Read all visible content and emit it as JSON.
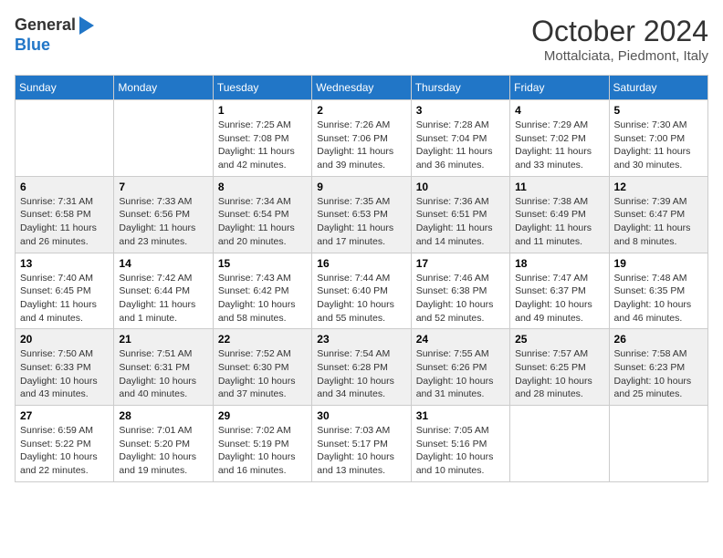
{
  "header": {
    "logo_general": "General",
    "logo_blue": "Blue",
    "month": "October 2024",
    "location": "Mottalciata, Piedmont, Italy"
  },
  "days_of_week": [
    "Sunday",
    "Monday",
    "Tuesday",
    "Wednesday",
    "Thursday",
    "Friday",
    "Saturday"
  ],
  "weeks": [
    [
      {
        "day": "",
        "content": ""
      },
      {
        "day": "",
        "content": ""
      },
      {
        "day": "1",
        "content": "Sunrise: 7:25 AM\nSunset: 7:08 PM\nDaylight: 11 hours and 42 minutes."
      },
      {
        "day": "2",
        "content": "Sunrise: 7:26 AM\nSunset: 7:06 PM\nDaylight: 11 hours and 39 minutes."
      },
      {
        "day": "3",
        "content": "Sunrise: 7:28 AM\nSunset: 7:04 PM\nDaylight: 11 hours and 36 minutes."
      },
      {
        "day": "4",
        "content": "Sunrise: 7:29 AM\nSunset: 7:02 PM\nDaylight: 11 hours and 33 minutes."
      },
      {
        "day": "5",
        "content": "Sunrise: 7:30 AM\nSunset: 7:00 PM\nDaylight: 11 hours and 30 minutes."
      }
    ],
    [
      {
        "day": "6",
        "content": "Sunrise: 7:31 AM\nSunset: 6:58 PM\nDaylight: 11 hours and 26 minutes."
      },
      {
        "day": "7",
        "content": "Sunrise: 7:33 AM\nSunset: 6:56 PM\nDaylight: 11 hours and 23 minutes."
      },
      {
        "day": "8",
        "content": "Sunrise: 7:34 AM\nSunset: 6:54 PM\nDaylight: 11 hours and 20 minutes."
      },
      {
        "day": "9",
        "content": "Sunrise: 7:35 AM\nSunset: 6:53 PM\nDaylight: 11 hours and 17 minutes."
      },
      {
        "day": "10",
        "content": "Sunrise: 7:36 AM\nSunset: 6:51 PM\nDaylight: 11 hours and 14 minutes."
      },
      {
        "day": "11",
        "content": "Sunrise: 7:38 AM\nSunset: 6:49 PM\nDaylight: 11 hours and 11 minutes."
      },
      {
        "day": "12",
        "content": "Sunrise: 7:39 AM\nSunset: 6:47 PM\nDaylight: 11 hours and 8 minutes."
      }
    ],
    [
      {
        "day": "13",
        "content": "Sunrise: 7:40 AM\nSunset: 6:45 PM\nDaylight: 11 hours and 4 minutes."
      },
      {
        "day": "14",
        "content": "Sunrise: 7:42 AM\nSunset: 6:44 PM\nDaylight: 11 hours and 1 minute."
      },
      {
        "day": "15",
        "content": "Sunrise: 7:43 AM\nSunset: 6:42 PM\nDaylight: 10 hours and 58 minutes."
      },
      {
        "day": "16",
        "content": "Sunrise: 7:44 AM\nSunset: 6:40 PM\nDaylight: 10 hours and 55 minutes."
      },
      {
        "day": "17",
        "content": "Sunrise: 7:46 AM\nSunset: 6:38 PM\nDaylight: 10 hours and 52 minutes."
      },
      {
        "day": "18",
        "content": "Sunrise: 7:47 AM\nSunset: 6:37 PM\nDaylight: 10 hours and 49 minutes."
      },
      {
        "day": "19",
        "content": "Sunrise: 7:48 AM\nSunset: 6:35 PM\nDaylight: 10 hours and 46 minutes."
      }
    ],
    [
      {
        "day": "20",
        "content": "Sunrise: 7:50 AM\nSunset: 6:33 PM\nDaylight: 10 hours and 43 minutes."
      },
      {
        "day": "21",
        "content": "Sunrise: 7:51 AM\nSunset: 6:31 PM\nDaylight: 10 hours and 40 minutes."
      },
      {
        "day": "22",
        "content": "Sunrise: 7:52 AM\nSunset: 6:30 PM\nDaylight: 10 hours and 37 minutes."
      },
      {
        "day": "23",
        "content": "Sunrise: 7:54 AM\nSunset: 6:28 PM\nDaylight: 10 hours and 34 minutes."
      },
      {
        "day": "24",
        "content": "Sunrise: 7:55 AM\nSunset: 6:26 PM\nDaylight: 10 hours and 31 minutes."
      },
      {
        "day": "25",
        "content": "Sunrise: 7:57 AM\nSunset: 6:25 PM\nDaylight: 10 hours and 28 minutes."
      },
      {
        "day": "26",
        "content": "Sunrise: 7:58 AM\nSunset: 6:23 PM\nDaylight: 10 hours and 25 minutes."
      }
    ],
    [
      {
        "day": "27",
        "content": "Sunrise: 6:59 AM\nSunset: 5:22 PM\nDaylight: 10 hours and 22 minutes."
      },
      {
        "day": "28",
        "content": "Sunrise: 7:01 AM\nSunset: 5:20 PM\nDaylight: 10 hours and 19 minutes."
      },
      {
        "day": "29",
        "content": "Sunrise: 7:02 AM\nSunset: 5:19 PM\nDaylight: 10 hours and 16 minutes."
      },
      {
        "day": "30",
        "content": "Sunrise: 7:03 AM\nSunset: 5:17 PM\nDaylight: 10 hours and 13 minutes."
      },
      {
        "day": "31",
        "content": "Sunrise: 7:05 AM\nSunset: 5:16 PM\nDaylight: 10 hours and 10 minutes."
      },
      {
        "day": "",
        "content": ""
      },
      {
        "day": "",
        "content": ""
      }
    ]
  ]
}
